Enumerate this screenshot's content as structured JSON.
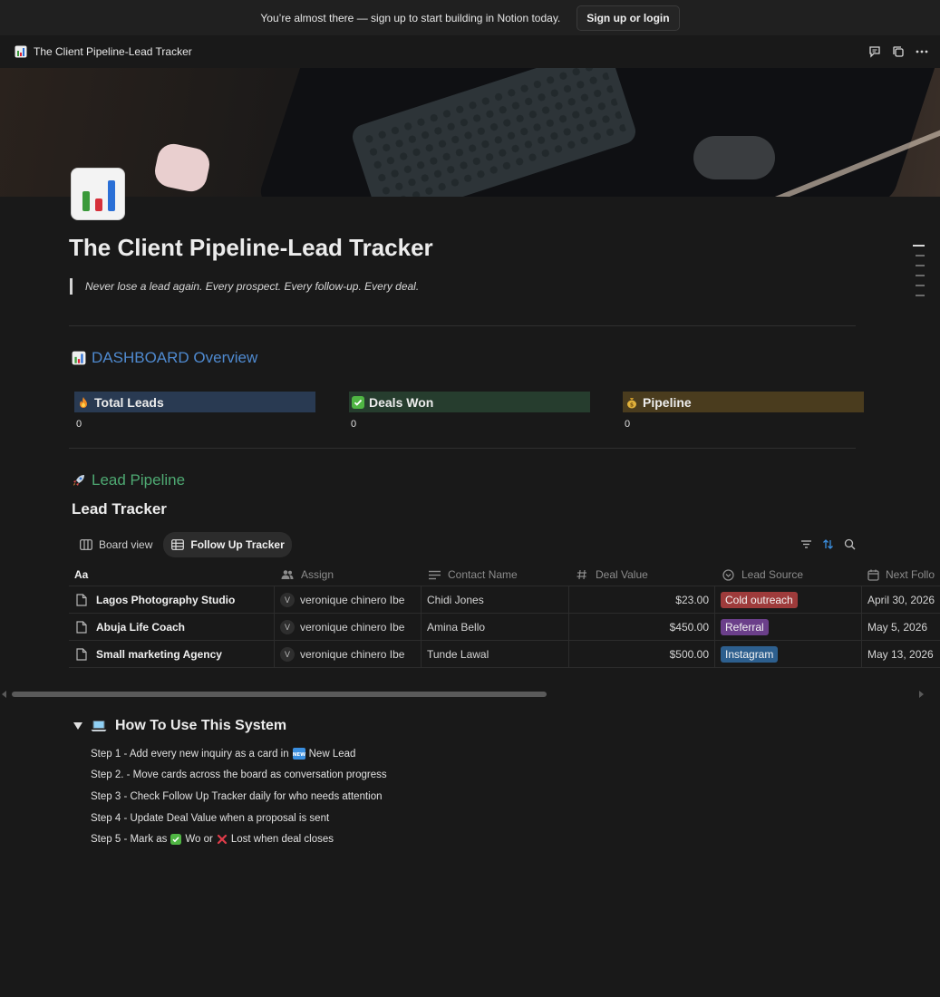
{
  "banner": {
    "text": "You’re almost there — sign up to start building in Notion today.",
    "button": "Sign up or login"
  },
  "topbar": {
    "page_title": "The Client Pipeline-Lead Tracker"
  },
  "page": {
    "title": "The Client Pipeline-Lead Tracker",
    "quote": "Never lose a lead again. Every prospect. Every follow-up. Every deal."
  },
  "dashboard": {
    "heading": "DASHBOARD Overview",
    "stats": [
      {
        "label": "Total Leads",
        "value": "0",
        "color": "#293a52"
      },
      {
        "label": "Deals Won",
        "value": "0",
        "color": "#263d2e"
      },
      {
        "label": "Pipeline",
        "value": "0",
        "color": "#4a3c1e"
      }
    ]
  },
  "pipeline": {
    "heading": "Lead Pipeline",
    "db_title": "Lead Tracker",
    "views": [
      "Board view",
      "Follow Up Tracker"
    ],
    "columns": [
      "Aa",
      "Assign",
      "Contact Name",
      "Deal Value",
      "Lead Source",
      "Next Follo"
    ],
    "rows": [
      {
        "name": "Lagos Photography Studio",
        "assign": "veronique chinero Ibe",
        "avatar": "V",
        "contact": "Chidi Jones",
        "value": "$23.00",
        "source": "Cold outreach",
        "source_color": "#9e3b3b",
        "next": "April 30, 2026"
      },
      {
        "name": "Abuja Life Coach",
        "assign": "veronique chinero Ibe",
        "avatar": "V",
        "contact": "Amina Bello",
        "value": "$450.00",
        "source": "Referral",
        "source_color": "#6b3f8a",
        "next": "May 5, 2026"
      },
      {
        "name": "Small marketing Agency",
        "assign": "veronique chinero Ibe",
        "avatar": "V",
        "contact": "Tunde Lawal",
        "value": "$500.00",
        "source": "Instagram",
        "source_color": "#2d5f8e",
        "next": "May 13, 2026"
      }
    ]
  },
  "howto": {
    "heading": "How To Use This System",
    "steps": {
      "s1a": "Step 1 - Add every new inquiry as a card in",
      "s1b": "New Lead",
      "s2": "Step 2. - Move cards across the board as conversation progress",
      "s3": "Step 3 - Check Follow Up Tracker daily for who needs attention",
      "s4": "Step 4 - Update Deal Value when a proposal is sent",
      "s5a": "Step 5 - Mark as",
      "s5b": "Wo or",
      "s5c": "Lost when deal closes"
    }
  },
  "icons": [
    "chart-icon",
    "comment-icon",
    "duplicate-icon",
    "more-icon",
    "fire-icon",
    "check-icon",
    "money-bag-icon",
    "rocket-icon",
    "laptop-icon",
    "new-icon",
    "cross-icon",
    "filter-icon",
    "sort-icon",
    "search-icon"
  ]
}
